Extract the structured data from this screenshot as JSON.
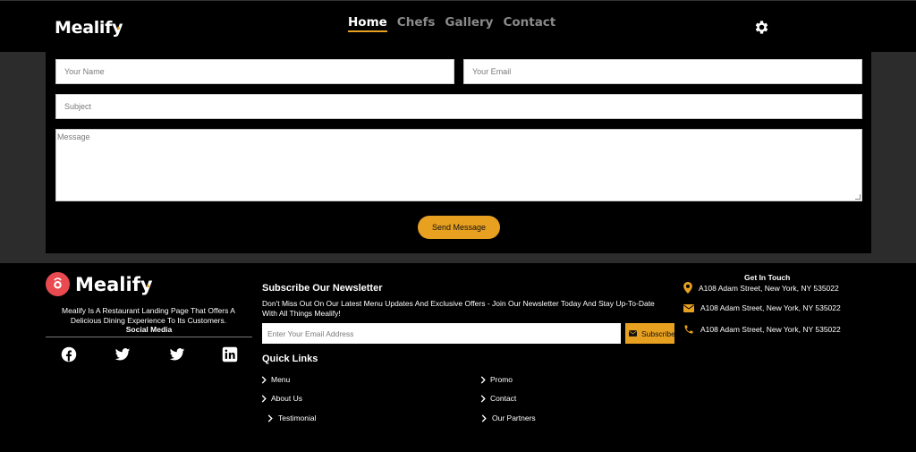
{
  "header": {
    "logo": "Mealify",
    "nav": [
      "Home",
      "Chefs",
      "Gallery",
      "Contact"
    ],
    "settings_icon": "gear-icon"
  },
  "contact_form": {
    "name_placeholder": "Your Name",
    "email_placeholder": "Your Email",
    "subject_placeholder": "Subject",
    "message_placeholder": "Message",
    "send_label": "Send Message"
  },
  "footer": {
    "logo": "Mealify",
    "about": "Mealify Is A Restaurant Landing Page That Offers A Delicious Dining Experience To Its Customers.",
    "social_heading": "Social Media",
    "social_icons": [
      "facebook-icon",
      "twitter-icon",
      "twitter-icon",
      "linkedin-icon"
    ],
    "newsletter": {
      "title": "Subscribe Our Newsletter",
      "text": "Don't Miss Out On Our Latest Menu Updates And Exclusive Offers - Join Our Newsletter Today And Stay Up-To-Date With All Things Mealify!",
      "input_placeholder": "Enter Your Email Address",
      "button_label": "Subscribe"
    },
    "quick_links": {
      "title": "Quick Links",
      "left": [
        "Menu",
        "About Us",
        "Testimonial"
      ],
      "right": [
        "Promo",
        "Contact",
        "Our Partners"
      ]
    },
    "get_in_touch": {
      "title": "Get In Touch",
      "items": [
        {
          "icon": "location-pin-icon",
          "text": "A108 Adam Street, New York, NY 535022"
        },
        {
          "icon": "envelope-icon",
          "text": "A108 Adam Street, New York, NY 535022"
        },
        {
          "icon": "phone-icon",
          "text": "A108 Adam Street, New York, NY 535022"
        }
      ]
    }
  },
  "colors": {
    "accent": "#e8a020",
    "background": "#000000",
    "section_bg": "#2c2c2c",
    "logo_badge": "#e84a50"
  }
}
